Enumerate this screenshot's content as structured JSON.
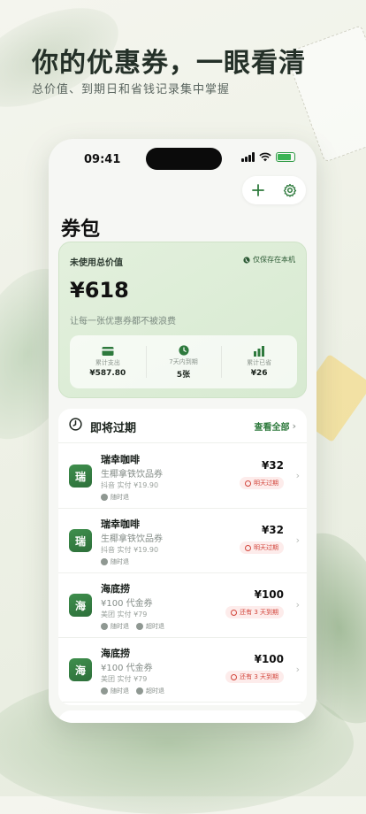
{
  "headline": "你的优惠券，一眼看清",
  "subheadline": "总价值、到期日和省钱记录集中掌握",
  "status_bar": {
    "time": "09:41"
  },
  "wallet": {
    "title": "券包",
    "summary": {
      "label": "未使用总价值",
      "local_tag": "仅保存在本机",
      "amount": "¥618",
      "note": "让每一张优惠券都不被浪费",
      "stats": [
        {
          "icon": "card-icon",
          "label": "累计支出",
          "value": "¥587.80"
        },
        {
          "icon": "clock-icon",
          "label": "7天内到期",
          "value": "5张"
        },
        {
          "icon": "bar-chart-icon",
          "label": "累计已省",
          "value": "¥26"
        }
      ]
    },
    "expiring": {
      "title": "即将过期",
      "view_all": "查看全部",
      "items": [
        {
          "logo": "瑞",
          "brand": "瑞幸咖啡",
          "desc": "生椰拿铁饮品券",
          "meta": "抖音  实付 ¥19.90",
          "tags": [
            "随时退"
          ],
          "price": "¥32",
          "badge": "明天过期"
        },
        {
          "logo": "瑞",
          "brand": "瑞幸咖啡",
          "desc": "生椰拿铁饮品券",
          "meta": "抖音  实付 ¥19.90",
          "tags": [
            "随时退"
          ],
          "price": "¥32",
          "badge": "明天过期"
        },
        {
          "logo": "海",
          "brand": "海底捞",
          "desc": "¥100 代金券",
          "meta": "美团  实付 ¥79",
          "tags": [
            "随时退",
            "超时退"
          ],
          "price": "¥100",
          "badge": "还有 3 天到期"
        },
        {
          "logo": "海",
          "brand": "海底捞",
          "desc": "¥100 代金券",
          "meta": "美团  实付 ¥79",
          "tags": [
            "随时退",
            "超时退"
          ],
          "price": "¥100",
          "badge": "还有 3 天到期"
        }
      ]
    }
  },
  "colors": {
    "accent": "#2e7a3d",
    "danger": "#d2453b",
    "summary_bg": "#dcecd6"
  }
}
